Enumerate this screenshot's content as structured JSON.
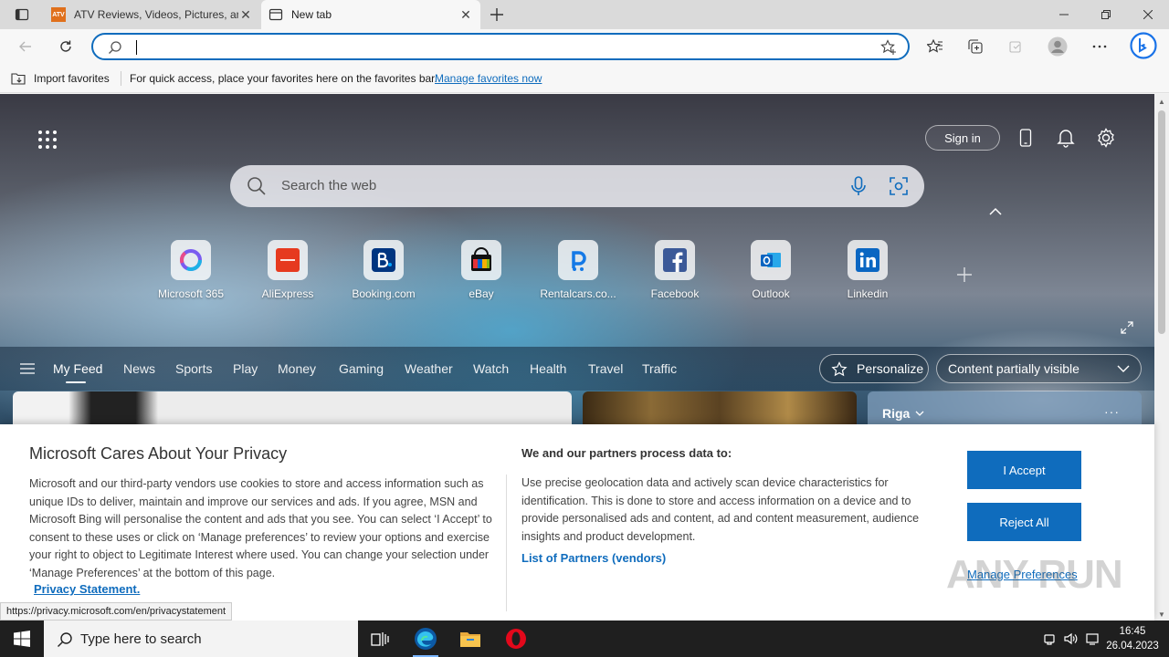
{
  "browser": {
    "tabs": [
      {
        "title": "ATV Reviews, Videos, Pictures, an",
        "favicon_text": "ATV",
        "active": false
      },
      {
        "title": "New tab",
        "active": true
      }
    ],
    "address": {
      "value": "",
      "placeholder": ""
    },
    "favorites_bar": {
      "import_label": "Import favorites",
      "hint": "For quick access, place your favorites here on the favorites bar.",
      "manage_link": "Manage favorites now"
    }
  },
  "newtab": {
    "sign_in": "Sign in",
    "search_placeholder": "Search the web",
    "quick_links": [
      {
        "label": "Microsoft 365",
        "icon": "microsoft-365-icon"
      },
      {
        "label": "AliExpress",
        "icon": "aliexpress-icon"
      },
      {
        "label": "Booking.com",
        "icon": "booking-icon"
      },
      {
        "label": "eBay",
        "icon": "ebay-icon"
      },
      {
        "label": "Rentalcars.co...",
        "icon": "rentalcars-icon"
      },
      {
        "label": "Facebook",
        "icon": "facebook-icon"
      },
      {
        "label": "Outlook",
        "icon": "outlook-icon"
      },
      {
        "label": "Linkedin",
        "icon": "linkedin-icon"
      }
    ],
    "feed_nav": [
      "My Feed",
      "News",
      "Sports",
      "Play",
      "Money",
      "Gaming",
      "Weather",
      "Watch",
      "Health",
      "Travel",
      "Traffic"
    ],
    "personalize": "Personalize",
    "content_visibility": "Content partially visible",
    "weather_city": "Riga",
    "weather_more": "···"
  },
  "privacy": {
    "title": "Microsoft Cares About Your Privacy",
    "body": "Microsoft and our third-party vendors use cookies to store and access information such as unique IDs to deliver, maintain and improve our services and ads. If you agree, MSN and Microsoft Bing will personalise the content and ads that you see. You can select ‘I Accept’ to consent to these uses or click on ‘Manage preferences’ to review your options and exercise your right to object to Legitimate Interest where used.  You can change your selection under ‘Manage Preferences’ at the bottom of this page.",
    "privacy_link": "Privacy Statement.",
    "purposes_heading": "We and our partners process data to:",
    "purposes_text": "Use precise geolocation data and actively scan device characteristics for identification. This is done to store and access information on a device and to provide personalised ads and content, ad and content measurement, audience insights and product development.",
    "partners_link": "List of Partners (vendors)",
    "accept": "I Accept",
    "reject": "Reject All",
    "manage": "Manage Preferences"
  },
  "status_url": "https://privacy.microsoft.com/en/privacystatement",
  "watermark": "ANY RUN",
  "taskbar": {
    "search_placeholder": "Type here to search",
    "time": "16:45",
    "date": "26.04.2023"
  },
  "colors": {
    "accent": "#0f6cbd",
    "taskbar": "#1f1f1f"
  }
}
